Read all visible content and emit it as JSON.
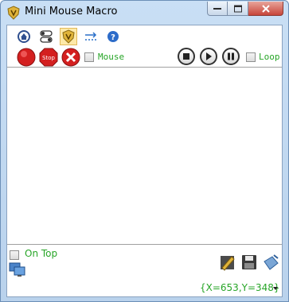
{
  "window": {
    "title": "Mini Mouse Macro",
    "app_icon": "shield-logo-icon",
    "caption_buttons": [
      "minimize-icon",
      "maximize-icon",
      "close-icon"
    ]
  },
  "toolbar": {
    "row1_icons": [
      "home-icon",
      "toggles-icon",
      "macro-shield-icon",
      "arrow-dots-icon",
      "help-icon"
    ],
    "record_label": "",
    "stop_record_label": "Stop",
    "mouse_label": "Mouse",
    "loop_label": "Loop",
    "mouse_checked": false,
    "loop_checked": false
  },
  "list": {
    "rows": []
  },
  "bottom": {
    "ontop_label": "On Top",
    "ontop_checked": false,
    "coords": "{X=653,Y=348}"
  },
  "colors": {
    "accent_green": "#27a527",
    "record_red": "#d42020",
    "titlebar": "#c9dff5"
  }
}
